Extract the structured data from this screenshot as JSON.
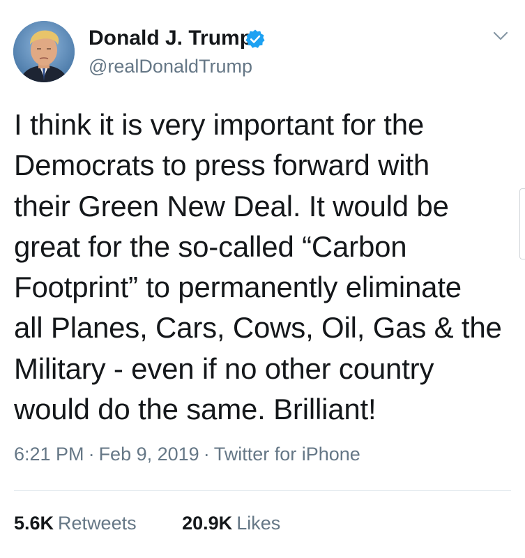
{
  "author": {
    "display_name": "Donald J. Trump",
    "handle": "@realDonaldTrump",
    "verified": true,
    "verified_color": "#1da1f2"
  },
  "icons": {
    "avatar": "profile-photo",
    "verified": "verified-badge-icon",
    "menu": "chevron-down-icon"
  },
  "tweet": {
    "text_lines": [
      "I think it is very important for the",
      "Democrats to press forward with",
      "their Green New Deal. It would be",
      "great for the so-called “Carbon",
      "Footprint” to permanently eliminate",
      "all Planes, Cars, Cows, Oil, Gas & the",
      "Military - even if no other country",
      "would do the same. Brilliant!"
    ]
  },
  "meta": {
    "time": "6:21 PM",
    "date": "Feb 9, 2019",
    "source": "Twitter for iPhone",
    "separator": "·"
  },
  "stats": {
    "retweets_count": "5.6K",
    "retweets_label": "Retweets",
    "likes_count": "20.9K",
    "likes_label": "Likes"
  }
}
